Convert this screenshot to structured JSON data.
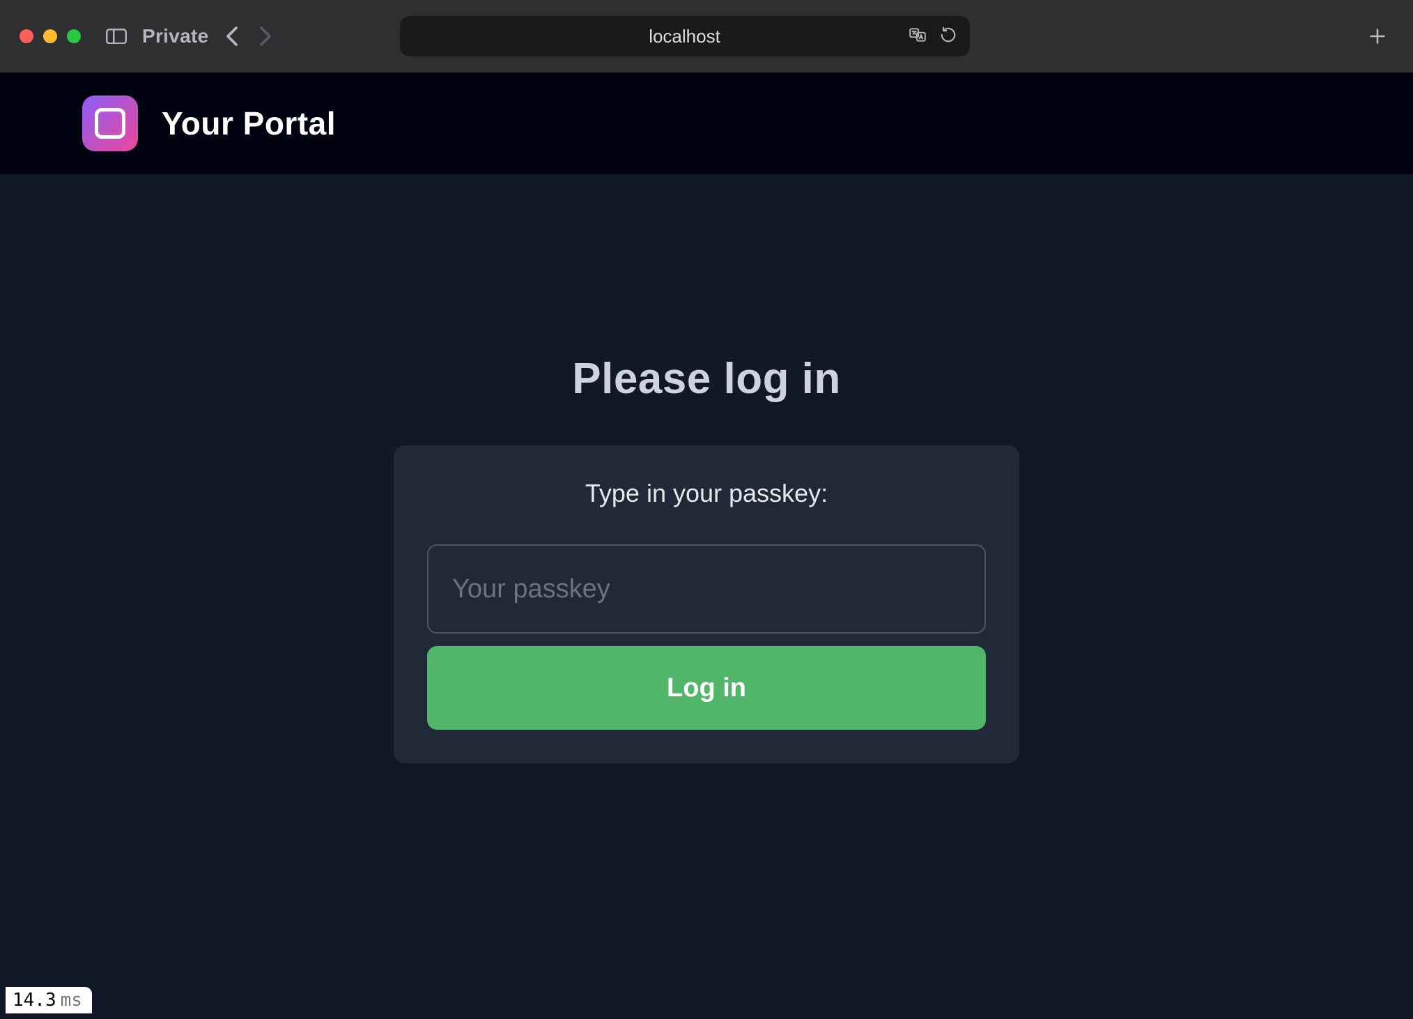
{
  "browser": {
    "private_label": "Private",
    "address": "localhost"
  },
  "header": {
    "title": "Your Portal"
  },
  "login": {
    "page_title": "Please log in",
    "prompt": "Type in your passkey:",
    "placeholder": "Your passkey",
    "button_label": "Log in"
  },
  "timing": {
    "value": "14.3",
    "unit": "ms"
  },
  "colors": {
    "page_bg": "#111827",
    "card_bg": "#1f2937",
    "button_bg": "#51b56a",
    "logo_gradient_from": "#8b5cf6",
    "logo_gradient_to": "#ec4899"
  }
}
